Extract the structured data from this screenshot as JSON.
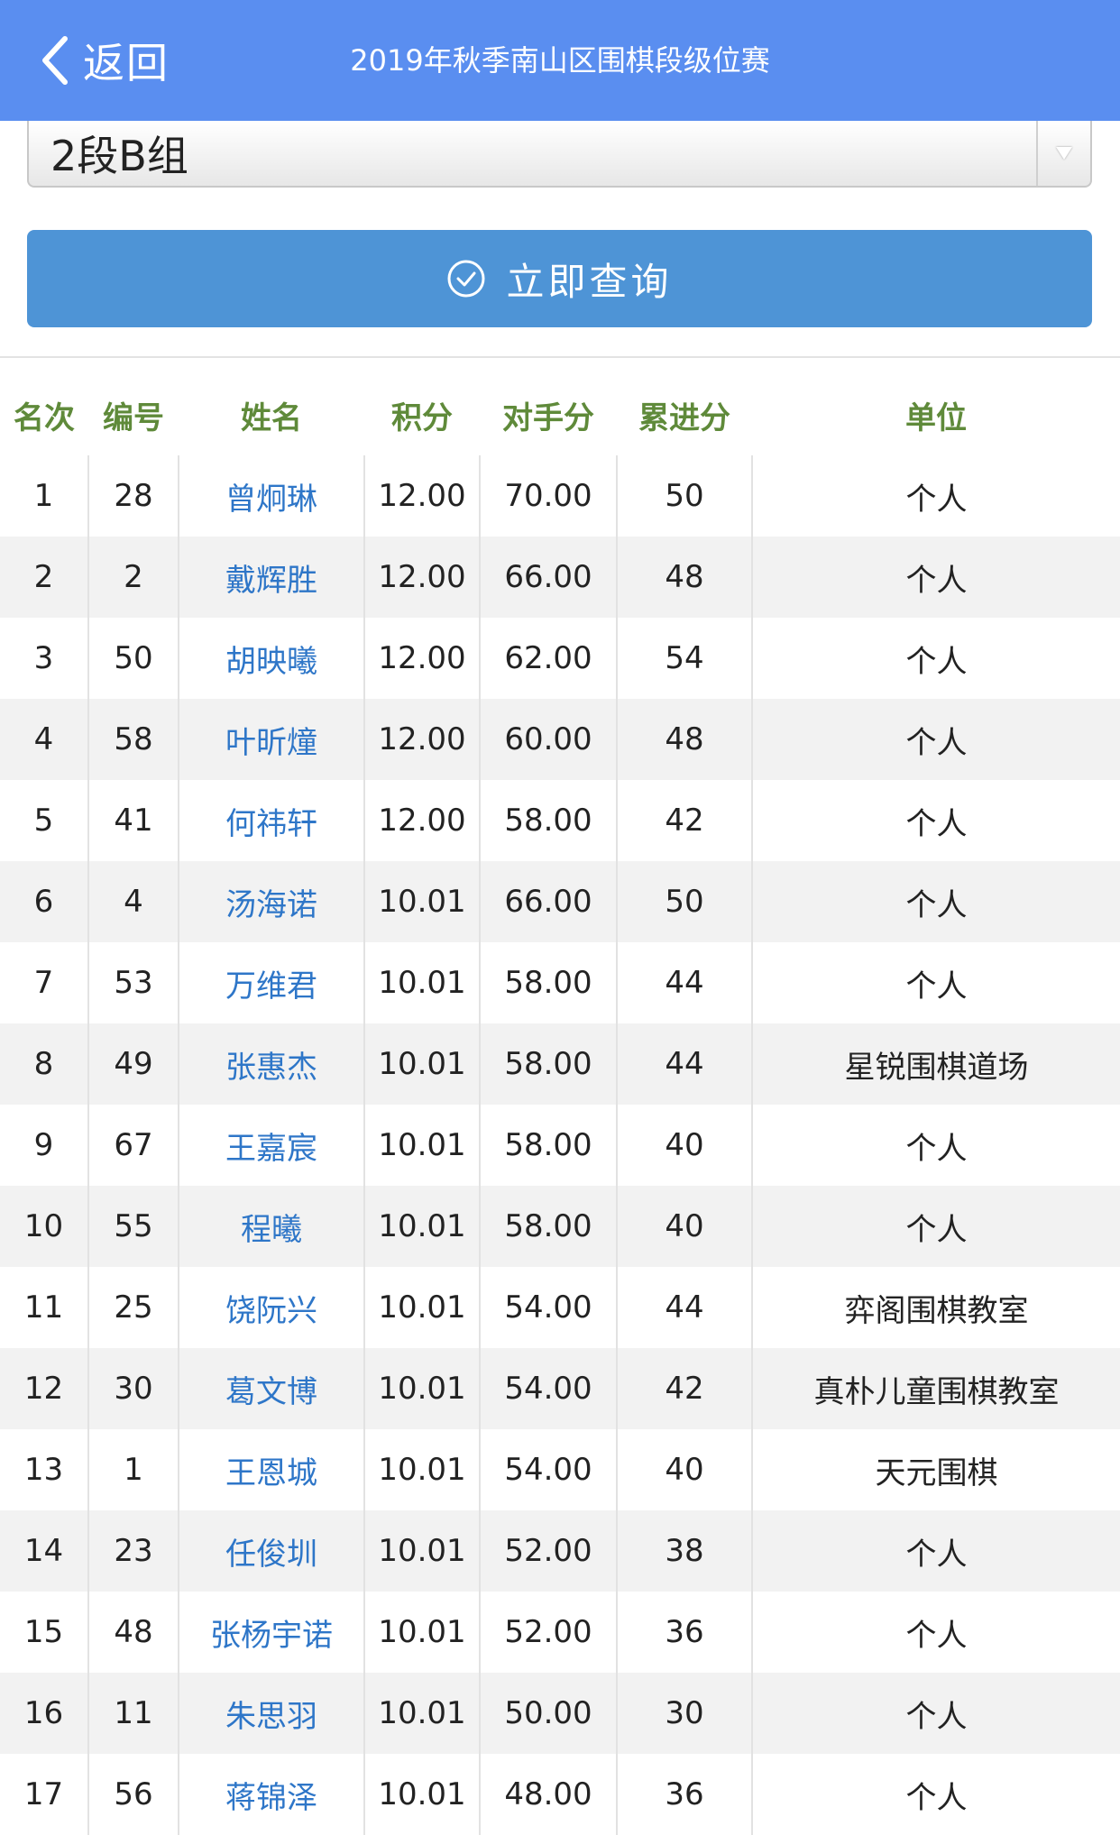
{
  "header": {
    "back_label": "返回",
    "title": "2019年秋季南山区围棋段级位赛"
  },
  "group_select": {
    "value": "2段B组"
  },
  "query_button": {
    "label": "立即查询"
  },
  "table": {
    "headers": [
      "名次",
      "编号",
      "姓名",
      "积分",
      "对手分",
      "累进分",
      "单位"
    ],
    "rows": [
      {
        "rank": "1",
        "id": "28",
        "name": "曾炯琳",
        "score": "12.00",
        "opp": "70.00",
        "cum": "50",
        "unit": "个人"
      },
      {
        "rank": "2",
        "id": "2",
        "name": "戴辉胜",
        "score": "12.00",
        "opp": "66.00",
        "cum": "48",
        "unit": "个人"
      },
      {
        "rank": "3",
        "id": "50",
        "name": "胡映曦",
        "score": "12.00",
        "opp": "62.00",
        "cum": "54",
        "unit": "个人"
      },
      {
        "rank": "4",
        "id": "58",
        "name": "叶昕燑",
        "score": "12.00",
        "opp": "60.00",
        "cum": "48",
        "unit": "个人"
      },
      {
        "rank": "5",
        "id": "41",
        "name": "何祎轩",
        "score": "12.00",
        "opp": "58.00",
        "cum": "42",
        "unit": "个人"
      },
      {
        "rank": "6",
        "id": "4",
        "name": "汤海诺",
        "score": "10.01",
        "opp": "66.00",
        "cum": "50",
        "unit": "个人"
      },
      {
        "rank": "7",
        "id": "53",
        "name": "万维君",
        "score": "10.01",
        "opp": "58.00",
        "cum": "44",
        "unit": "个人"
      },
      {
        "rank": "8",
        "id": "49",
        "name": "张惠杰",
        "score": "10.01",
        "opp": "58.00",
        "cum": "44",
        "unit": "星锐围棋道场"
      },
      {
        "rank": "9",
        "id": "67",
        "name": "王嘉宸",
        "score": "10.01",
        "opp": "58.00",
        "cum": "40",
        "unit": "个人"
      },
      {
        "rank": "10",
        "id": "55",
        "name": "程曦",
        "score": "10.01",
        "opp": "58.00",
        "cum": "40",
        "unit": "个人"
      },
      {
        "rank": "11",
        "id": "25",
        "name": "饶阮兴",
        "score": "10.01",
        "opp": "54.00",
        "cum": "44",
        "unit": "弈阁围棋教室"
      },
      {
        "rank": "12",
        "id": "30",
        "name": "葛文博",
        "score": "10.01",
        "opp": "54.00",
        "cum": "42",
        "unit": "真朴儿童围棋教室"
      },
      {
        "rank": "13",
        "id": "1",
        "name": "王恩城",
        "score": "10.01",
        "opp": "54.00",
        "cum": "40",
        "unit": "天元围棋"
      },
      {
        "rank": "14",
        "id": "23",
        "name": "任俊圳",
        "score": "10.01",
        "opp": "52.00",
        "cum": "38",
        "unit": "个人"
      },
      {
        "rank": "15",
        "id": "48",
        "name": "张杨宇诺",
        "score": "10.01",
        "opp": "52.00",
        "cum": "36",
        "unit": "个人"
      },
      {
        "rank": "16",
        "id": "11",
        "name": "朱思羽",
        "score": "10.01",
        "opp": "50.00",
        "cum": "30",
        "unit": "个人"
      },
      {
        "rank": "17",
        "id": "56",
        "name": "蒋锦泽",
        "score": "10.01",
        "opp": "48.00",
        "cum": "36",
        "unit": "个人"
      }
    ]
  }
}
